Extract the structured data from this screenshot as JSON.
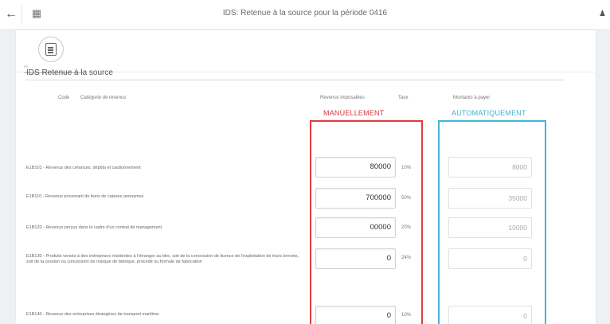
{
  "header": {
    "title": "IDS: Retenue à la source pour la période 0416",
    "back_icon": "arrow-left-icon",
    "home_icon": "building-icon",
    "user_icon": "user-icon"
  },
  "tab": {
    "icon": "document-icon",
    "label": "RS"
  },
  "section": {
    "title": "IDS   Retenue à la source"
  },
  "table": {
    "headers": {
      "code": "Code",
      "category": "Catégorie de revenus",
      "income": "Revenus imposables",
      "rate": "Taux",
      "amount": "Montants à payer"
    },
    "annotations": {
      "manual": "MANUELLEMENT",
      "auto": "AUTOMATIQUEMENT",
      "manual_color": "#df3b41",
      "auto_color": "#41b6d6"
    },
    "rows": [
      {
        "label": "E1B101 - Revenus des créances, dépôts et cautionnement",
        "income": "80000",
        "rate": "10%",
        "amount": "8000"
      },
      {
        "label": "E1B110 - Revenus provenant de bons de caisses anonymes",
        "income": "700000",
        "rate": "50%",
        "amount": "35000"
      },
      {
        "label": "E1B120 - Revenus perçus dans le cadre d'un contrat de management",
        "income": "00000",
        "rate": "20%",
        "amount": "10000"
      },
      {
        "label": "E1B130 - Produits versés à des entreprises résidentes à l'étranger au titre, soit de la concession de licence de l'exploitation de leurs brevets, soit de la cession ou concession de marque de fabrique, procédé ou formule de fabrication",
        "income": "0",
        "rate": "24%",
        "amount": "0"
      },
      {
        "label": "E1B140 - Revenus des entreprises étrangères de transport maritime",
        "income": "0",
        "rate": "10%",
        "amount": "0"
      }
    ]
  }
}
